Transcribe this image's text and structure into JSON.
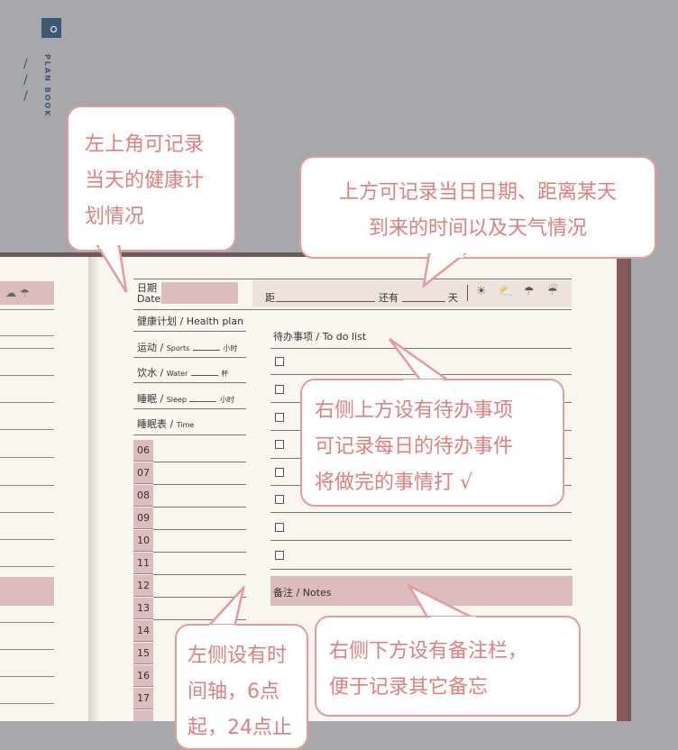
{
  "brand": {
    "text": "PLAN BOOK",
    "slashes": "/ / /"
  },
  "bubbles": {
    "health": [
      "左上角可记录",
      "当天的健康计",
      "划情况"
    ],
    "date": [
      "上方可记录当日日期、距离某天",
      "到来的时间以及天气情况"
    ],
    "todo": [
      "右侧上方设有待办事项",
      "可记录每日的待办事件",
      "将做完的事情打 √"
    ],
    "notes": [
      "右侧下方设有备注栏，",
      "便于记录其它备忘"
    ],
    "timeline": [
      "左侧设有时",
      "间轴，6点",
      "起，24点止"
    ]
  },
  "page": {
    "date_label_cn": "日期",
    "date_label_en": "Date",
    "distance_label": "距",
    "remaining_label": "还有",
    "day_unit": "天",
    "weather_icons": [
      "sun-icon",
      "partly-cloudy-icon",
      "cloud-rain-icon",
      "cloud-rain-icon"
    ],
    "health_title": "健康计划 / Health plan",
    "exercise": {
      "cn": "运动 /",
      "en": "Sports",
      "unit": "小时"
    },
    "water": {
      "cn": "饮水 /",
      "en": "Water",
      "unit": "杯"
    },
    "sleep": {
      "cn": "睡眠 /",
      "en": "Sleep",
      "unit": "小时"
    },
    "sleep_chart": {
      "cn": "睡眠表 /",
      "en": "Time"
    },
    "hours": [
      "06",
      "07",
      "08",
      "09",
      "10",
      "11",
      "12",
      "13",
      "14",
      "15",
      "16",
      "17"
    ],
    "todo_title": "待办事项 / To do list",
    "notes_title": "备注 / Notes"
  }
}
